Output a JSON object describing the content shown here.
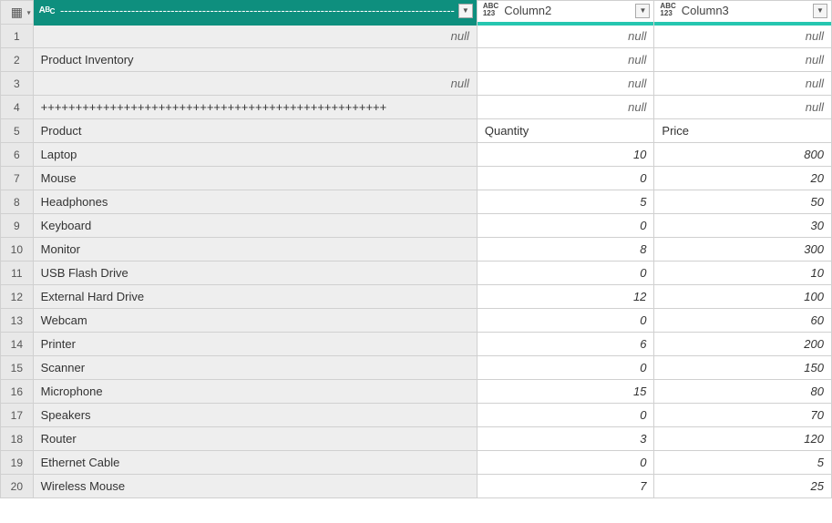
{
  "columns": [
    {
      "name": "----------------------------------------------------------------------------------------------------",
      "type_icon": "ABC",
      "selected": true
    },
    {
      "name": "Column2",
      "type_icon": "ABC123",
      "selected": false
    },
    {
      "name": "Column3",
      "type_icon": "ABC123",
      "selected": false
    }
  ],
  "rows": [
    {
      "n": "1",
      "c1": null,
      "c2": null,
      "c3": null
    },
    {
      "n": "2",
      "c1": "Product Inventory",
      "c2": null,
      "c3": null
    },
    {
      "n": "3",
      "c1": null,
      "c2": null,
      "c3": null
    },
    {
      "n": "4",
      "c1": "++++++++++++++++++++++++++++++++++++++++++++++++++",
      "c2": null,
      "c3": null
    },
    {
      "n": "5",
      "c1": "Product",
      "c2": "Quantity",
      "c3": "Price"
    },
    {
      "n": "6",
      "c1": "Laptop",
      "c2": 10,
      "c3": 800
    },
    {
      "n": "7",
      "c1": "Mouse",
      "c2": 0,
      "c3": 20
    },
    {
      "n": "8",
      "c1": "Headphones",
      "c2": 5,
      "c3": 50
    },
    {
      "n": "9",
      "c1": "Keyboard",
      "c2": 0,
      "c3": 30
    },
    {
      "n": "10",
      "c1": "Monitor",
      "c2": 8,
      "c3": 300
    },
    {
      "n": "11",
      "c1": "USB Flash Drive",
      "c2": 0,
      "c3": 10
    },
    {
      "n": "12",
      "c1": "External Hard Drive",
      "c2": 12,
      "c3": 100
    },
    {
      "n": "13",
      "c1": "Webcam",
      "c2": 0,
      "c3": 60
    },
    {
      "n": "14",
      "c1": "Printer",
      "c2": 6,
      "c3": 200
    },
    {
      "n": "15",
      "c1": "Scanner",
      "c2": 0,
      "c3": 150
    },
    {
      "n": "16",
      "c1": "Microphone",
      "c2": 15,
      "c3": 80
    },
    {
      "n": "17",
      "c1": "Speakers",
      "c2": 0,
      "c3": 70
    },
    {
      "n": "18",
      "c1": "Router",
      "c2": 3,
      "c3": 120
    },
    {
      "n": "19",
      "c1": "Ethernet Cable",
      "c2": 0,
      "c3": 5
    },
    {
      "n": "20",
      "c1": "Wireless Mouse",
      "c2": 7,
      "c3": 25
    }
  ],
  "null_label": "null",
  "chart_data": {
    "type": "table",
    "columns": [
      "Product",
      "Quantity",
      "Price"
    ],
    "data": [
      [
        "Laptop",
        10,
        800
      ],
      [
        "Mouse",
        0,
        20
      ],
      [
        "Headphones",
        5,
        50
      ],
      [
        "Keyboard",
        0,
        30
      ],
      [
        "Monitor",
        8,
        300
      ],
      [
        "USB Flash Drive",
        0,
        10
      ],
      [
        "External Hard Drive",
        12,
        100
      ],
      [
        "Webcam",
        0,
        60
      ],
      [
        "Printer",
        6,
        200
      ],
      [
        "Scanner",
        0,
        150
      ],
      [
        "Microphone",
        15,
        80
      ],
      [
        "Speakers",
        0,
        70
      ],
      [
        "Router",
        3,
        120
      ],
      [
        "Ethernet Cable",
        0,
        5
      ],
      [
        "Wireless Mouse",
        7,
        25
      ]
    ],
    "title": "Product Inventory"
  }
}
